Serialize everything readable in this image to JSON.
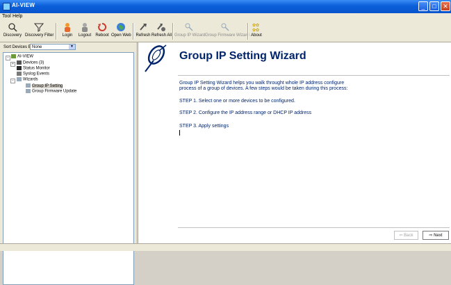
{
  "window": {
    "title": "AI-VIEW"
  },
  "menu": {
    "items": [
      "Tool",
      "Help"
    ]
  },
  "toolbar": {
    "buttons": [
      {
        "label": "Discovery",
        "icon": "magnifier-icon"
      },
      {
        "label": "Discovery Filter",
        "icon": "filter-icon"
      },
      {
        "label": "Login",
        "icon": "login-icon"
      },
      {
        "label": "Logout",
        "icon": "logout-icon"
      },
      {
        "label": "Reboot",
        "icon": "reboot-icon"
      },
      {
        "label": "Open Web",
        "icon": "globe-icon"
      },
      {
        "label": "Refresh",
        "icon": "refresh-icon"
      },
      {
        "label": "Refresh All",
        "icon": "refresh-all-icon"
      },
      {
        "label": "Group IP Wizard",
        "icon": "wand-icon"
      },
      {
        "label": "Group Firmware Wizard",
        "icon": "wand-icon"
      },
      {
        "label": "About",
        "icon": "about-icon"
      }
    ]
  },
  "sidebar": {
    "sort_label": "Sort Devices By:",
    "sort_value": "None",
    "tree": {
      "root": "AI-VIEW",
      "devices": "Devices (3)",
      "status_monitor": "Status Monitor",
      "syslog": "Syslog Events",
      "wizards": "Wizards",
      "group_ip": "Group IP Setting",
      "group_fw": "Group Firmware Update"
    }
  },
  "wizard": {
    "title": "Group IP Setting Wizard",
    "intro_line1": "Group IP Setting Wizard helps you walk throught whole IP address configure",
    "intro_line2": "process of a group of devices. A few steps would be taken during this process:",
    "step1": "STEP 1. Select one or more devices to be configured.",
    "step2": "STEP 2. Configure the IP address range or DHCP IP address",
    "step3": "STEP 3. Apply settings",
    "back_label": "Back",
    "next_label": "Next"
  },
  "colors": {
    "title_blue": "#00246b",
    "titlebar": "#0a5fd9"
  }
}
